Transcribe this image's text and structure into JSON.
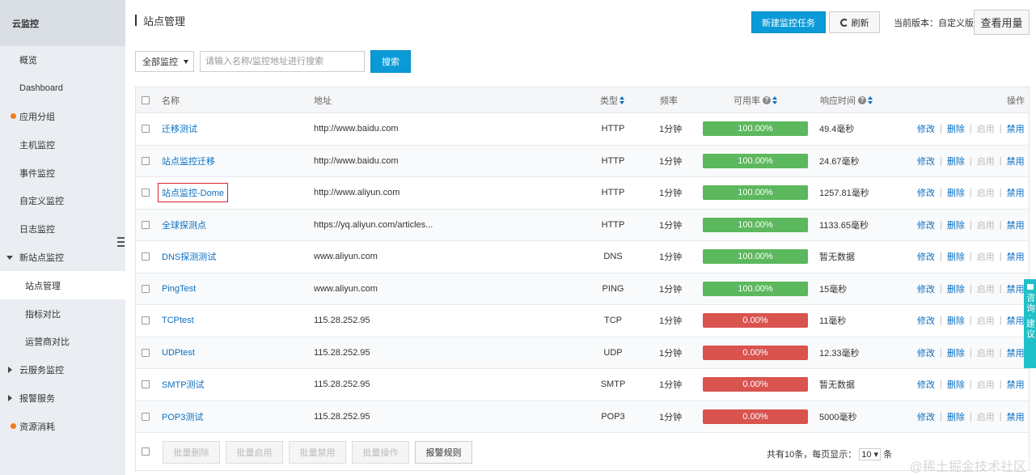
{
  "sidebar": {
    "title": "云监控",
    "items": [
      {
        "label": "概览",
        "type": "plain"
      },
      {
        "label": "Dashboard",
        "type": "plain"
      },
      {
        "label": "应用分组",
        "type": "dot"
      },
      {
        "label": "主机监控",
        "type": "plain"
      },
      {
        "label": "事件监控",
        "type": "plain"
      },
      {
        "label": "自定义监控",
        "type": "plain"
      },
      {
        "label": "日志监控",
        "type": "plain"
      },
      {
        "label": "新站点监控",
        "type": "expanded"
      },
      {
        "label": "站点管理",
        "type": "sub",
        "active": true
      },
      {
        "label": "指标对比",
        "type": "sub"
      },
      {
        "label": "运营商对比",
        "type": "sub"
      },
      {
        "label": "云服务监控",
        "type": "collapsed"
      },
      {
        "label": "报警服务",
        "type": "collapsed"
      },
      {
        "label": "资源消耗",
        "type": "dot"
      }
    ]
  },
  "header": {
    "title": "站点管理",
    "new_task_label": "新建监控任务",
    "refresh_label": "刷新",
    "version_text": "当前版本：自定义版",
    "usage_label": "查看用量"
  },
  "filter": {
    "select_value": "全部监控",
    "search_placeholder": "请输入名称/监控地址进行搜索",
    "search_button": "搜索"
  },
  "table": {
    "headers": {
      "name": "名称",
      "address": "地址",
      "type": "类型",
      "frequency": "频率",
      "availability": "可用率",
      "response": "响应时间",
      "ops": "操作"
    },
    "op_labels": {
      "edit": "修改",
      "delete": "删除",
      "enable": "启用",
      "disable": "禁用"
    },
    "rows": [
      {
        "name": "迁移测试",
        "address": "http://www.baidu.com",
        "type": "HTTP",
        "freq": "1分钟",
        "avail": "100.00%",
        "avail_pct": 100,
        "response": "49.4毫秒"
      },
      {
        "name": "站点监控迁移",
        "address": "http://www.baidu.com",
        "type": "HTTP",
        "freq": "1分钟",
        "avail": "100.00%",
        "avail_pct": 100,
        "response": "24.67毫秒"
      },
      {
        "name": "站点监控-Dome",
        "address": "http://www.aliyun.com",
        "type": "HTTP",
        "freq": "1分钟",
        "avail": "100.00%",
        "avail_pct": 100,
        "response": "1257.81毫秒",
        "highlight": true
      },
      {
        "name": "全球探测点",
        "address": "https://yq.aliyun.com/articles...",
        "type": "HTTP",
        "freq": "1分钟",
        "avail": "100.00%",
        "avail_pct": 100,
        "response": "1133.65毫秒"
      },
      {
        "name": "DNS探测测试",
        "address": "www.aliyun.com",
        "type": "DNS",
        "freq": "1分钟",
        "avail": "100.00%",
        "avail_pct": 100,
        "response": "暂无数据"
      },
      {
        "name": "PingTest",
        "address": "www.aliyun.com",
        "type": "PING",
        "freq": "1分钟",
        "avail": "100.00%",
        "avail_pct": 100,
        "response": "15毫秒"
      },
      {
        "name": "TCPtest",
        "address": "115.28.252.95",
        "type": "TCP",
        "freq": "1分钟",
        "avail": "0.00%",
        "avail_pct": 0,
        "response": "11毫秒"
      },
      {
        "name": "UDPtest",
        "address": "115.28.252.95",
        "type": "UDP",
        "freq": "1分钟",
        "avail": "0.00%",
        "avail_pct": 0,
        "response": "12.33毫秒"
      },
      {
        "name": "SMTP测试",
        "address": "115.28.252.95",
        "type": "SMTP",
        "freq": "1分钟",
        "avail": "0.00%",
        "avail_pct": 0,
        "response": "暂无数据"
      },
      {
        "name": "POP3测试",
        "address": "115.28.252.95",
        "type": "POP3",
        "freq": "1分钟",
        "avail": "0.00%",
        "avail_pct": 0,
        "response": "5000毫秒"
      }
    ]
  },
  "footer": {
    "batch_delete": "批量删除",
    "batch_enable": "批量启用",
    "batch_disable": "批量禁用",
    "batch_ops": "批量操作",
    "alarm_rules": "报警规则",
    "pager_prefix": "共有10条，每页显示：",
    "page_size": "10",
    "pager_suffix": "条"
  },
  "feedback": {
    "label": "咨询·建议"
  },
  "watermark": "@稀土掘金技术社区",
  "colors": {
    "primary": "#0a9ad7",
    "link": "#0a6fc2",
    "ok": "#5cb85c",
    "fail": "#d9534f"
  }
}
